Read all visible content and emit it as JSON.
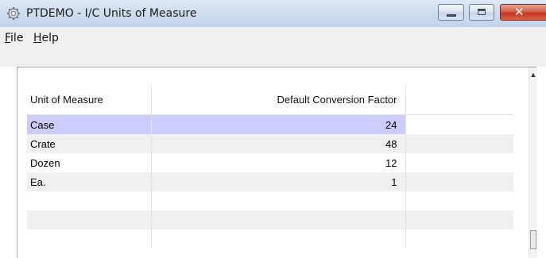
{
  "window": {
    "title": "PTDEMO - I/C Units of Measure",
    "icon": "gear-icon",
    "controls": {
      "minimize": "minimize-icon",
      "maximize": "maximize-icon",
      "close_label": "✕"
    }
  },
  "menu": {
    "items": [
      {
        "mnemonic": "F",
        "rest": "ile"
      },
      {
        "mnemonic": "H",
        "rest": "elp"
      }
    ]
  },
  "grid": {
    "columns": [
      "Unit of Measure",
      "Default Conversion Factor",
      ""
    ],
    "rows": [
      {
        "unit": "Case",
        "factor": "24",
        "selected": true
      },
      {
        "unit": "Crate",
        "factor": "48",
        "selected": false
      },
      {
        "unit": "Dozen",
        "factor": "12",
        "selected": false
      },
      {
        "unit": "Ea.",
        "factor": "1",
        "selected": false
      }
    ],
    "selected_color": "#ccccff",
    "alternate_row_color": "#f0f0f0",
    "scroll_up": "▲"
  }
}
